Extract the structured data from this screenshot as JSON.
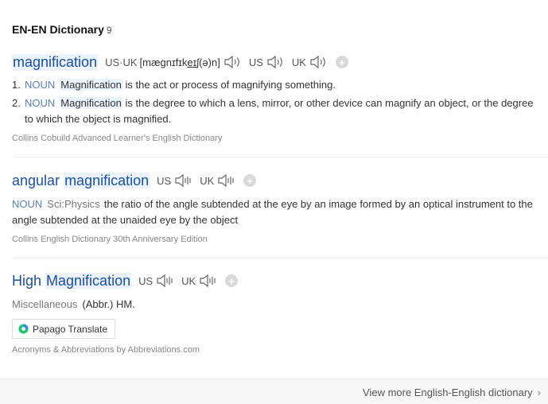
{
  "dictionary": {
    "title": "EN-EN Dictionary",
    "count": "9"
  },
  "entries": [
    {
      "headword": "magnification",
      "pronunciations": [
        {
          "label": "US·UK",
          "phonetic_pre": "[mæ",
          "phonetic_ul1": "g",
          "phonetic_mid": "nɪfɪk",
          "phonetic_ul2": "eɪ",
          "phonetic_post": "ʃ(ə)n]"
        },
        {
          "label": "US"
        },
        {
          "label": "UK"
        }
      ],
      "senses": [
        {
          "num": "1.",
          "pos": "NOUN",
          "term": "Magnification",
          "text": " is the act or process of magnifying something."
        },
        {
          "num": "2.",
          "pos": "NOUN",
          "term": "Magnification",
          "text": " is the degree to which a lens, mirror, or other device can magnify an object, or the degree to which the object is magnified."
        }
      ],
      "source": "Collins Cobuild Advanced Learner's English Dictionary"
    },
    {
      "headword_plain": "angular ",
      "headword_hl": "magnification",
      "pronunciations": [
        {
          "label": "US"
        },
        {
          "label": "UK"
        }
      ],
      "pos": "NOUN",
      "domain": "Sci:Physics",
      "definition": "the ratio of the angle subtended at the eye by an image formed by an optical instrument to the angle subtended at the unaided eye by the object",
      "source": "Collins English Dictionary 30th Anniversary Edition"
    },
    {
      "headword_plain": "High ",
      "headword_hl": "Magnification",
      "pronunciations": [
        {
          "label": "US"
        },
        {
          "label": "UK"
        }
      ],
      "category": "Miscellaneous",
      "abbr": "(Abbr.) HM.",
      "translate_label": "Papago Translate",
      "source": "Acronyms & Abbreviations by Abbreviations.com"
    }
  ],
  "footer": {
    "view_more": "View more English-English dictionary"
  },
  "icons": {
    "speaker": "speaker-icon",
    "add": "plus-icon",
    "papago": "papago-logo-icon",
    "chevron": "chevron-right-icon"
  },
  "colors": {
    "headword": "#1c4fa3",
    "pos": "#5a7fb5",
    "highlight": "#eaf2fb"
  }
}
